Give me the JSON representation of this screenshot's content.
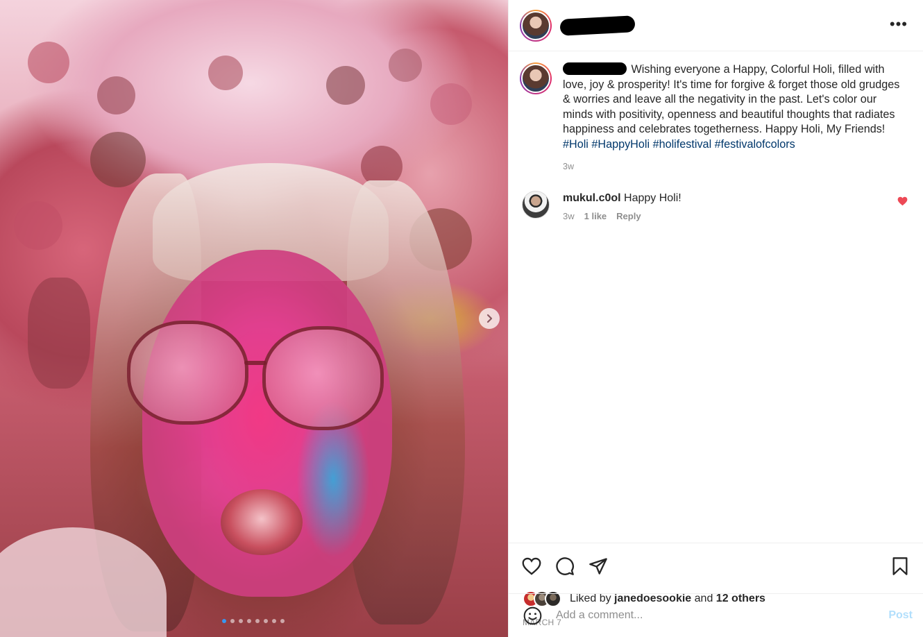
{
  "post": {
    "carousel": {
      "slide_count": 8,
      "active_index": 0,
      "next_icon": "chevron-right-icon"
    },
    "header": {
      "more_icon": "more-horizontal-icon",
      "more_label": "•••"
    },
    "caption": {
      "text_before_tags": "Wishing everyone a Happy, Colorful Holi, filled with love, joy & prosperity! It's time for forgive & forget those old grudges & worries and leave all the negativity in the past. Let's color our minds with positivity, openness and beautiful thoughts that radiates happiness and celebrates togetherness. Happy Holi, My Friends! ",
      "hashtags": [
        "#Holi",
        "#HappyHoli",
        "#holifestival",
        "#festivalofcolors"
      ],
      "time": "3w"
    },
    "comments": [
      {
        "username": "mukul.c0ol",
        "text": "Happy Holi!",
        "time": "3w",
        "likes": "1 like",
        "reply_label": "Reply",
        "liked": true,
        "heart_icon": "heart-filled-icon"
      }
    ],
    "actions": {
      "like_icon": "heart-outline-icon",
      "comment_icon": "comment-icon",
      "share_icon": "paper-plane-icon",
      "save_icon": "bookmark-icon"
    },
    "likes": {
      "prefix": "Liked by ",
      "user": "janedoesookie",
      "middle": " and ",
      "others": "12 others"
    },
    "date": "MARCH 7",
    "add_comment": {
      "emoji_icon": "smiley-icon",
      "placeholder": "Add a comment...",
      "value": "",
      "post_label": "Post"
    },
    "colors": {
      "hashtag": "#00376b",
      "liked_heart": "#ed4956",
      "post_button_disabled": "#b2dffc",
      "active_dot": "#3897f0"
    }
  }
}
